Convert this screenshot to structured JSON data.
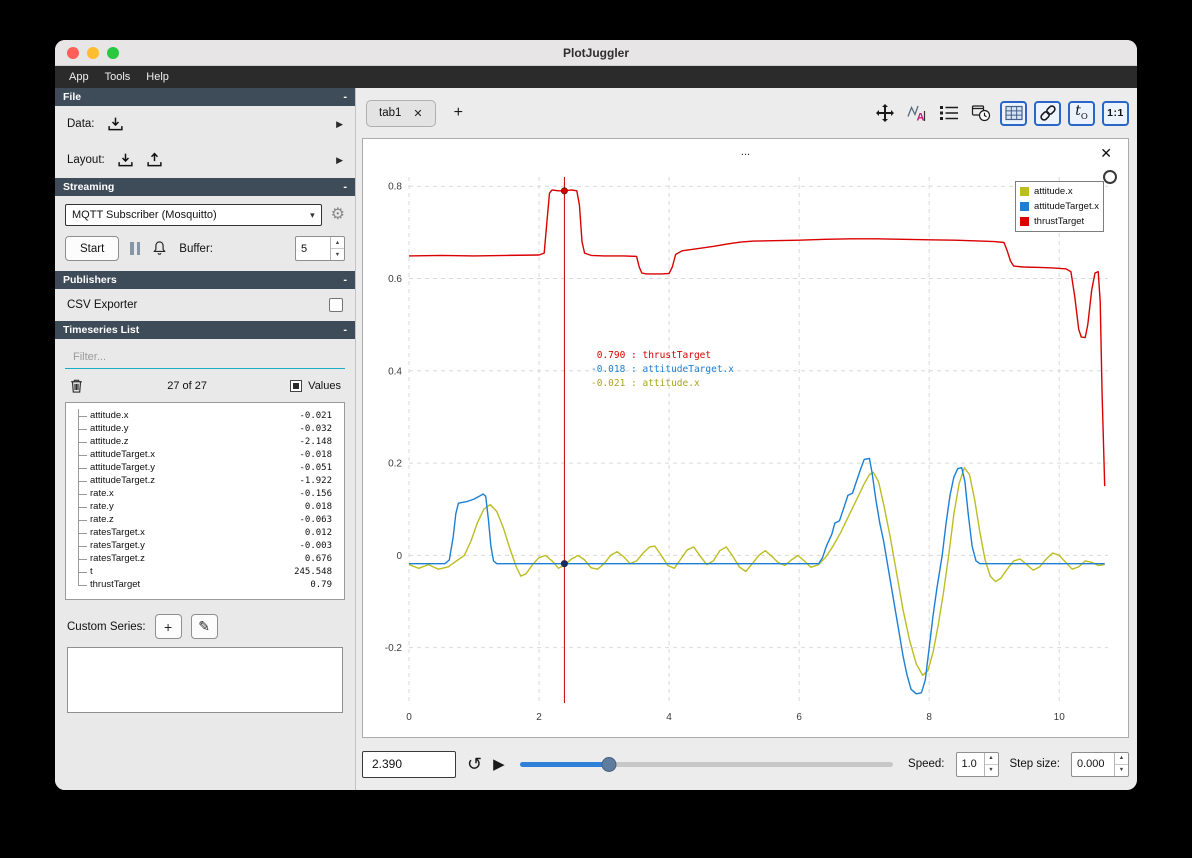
{
  "window": {
    "title": "PlotJuggler"
  },
  "menu": {
    "items": [
      "App",
      "Tools",
      "Help"
    ]
  },
  "icons": {
    "collapse": "-",
    "right_arrow": "▶",
    "chevron_down": "▾",
    "gear": "⚙",
    "pencil": "✎",
    "plus": "+",
    "close": "✕",
    "play": "▶",
    "loop": "↺",
    "up_arrow": "▲",
    "down_arrow": "▼",
    "t_main": "t",
    "t_sub": "O",
    "one_to_one": "1:1"
  },
  "sidebar": {
    "file": {
      "header": "File",
      "data_label": "Data:",
      "layout_label": "Layout:"
    },
    "streaming": {
      "header": "Streaming",
      "source": "MQTT Subscriber (Mosquitto)",
      "start_label": "Start",
      "buffer_label": "Buffer:",
      "buffer_value": "5"
    },
    "publishers": {
      "header": "Publishers",
      "csv_label": "CSV Exporter"
    },
    "timeseries": {
      "header": "Timeseries List",
      "filter_placeholder": "Filter...",
      "count": "27 of 27",
      "values_label": "Values",
      "custom_series_label": "Custom Series:",
      "items": [
        {
          "name": "attitude.x",
          "value": "-0.021"
        },
        {
          "name": "attitude.y",
          "value": "-0.032"
        },
        {
          "name": "attitude.z",
          "value": "-2.148"
        },
        {
          "name": "attitudeTarget.x",
          "value": "-0.018"
        },
        {
          "name": "attitudeTarget.y",
          "value": "-0.051"
        },
        {
          "name": "attitudeTarget.z",
          "value": "-1.922"
        },
        {
          "name": "rate.x",
          "value": "-0.156"
        },
        {
          "name": "rate.y",
          "value": "0.018"
        },
        {
          "name": "rate.z",
          "value": "-0.063"
        },
        {
          "name": "ratesTarget.x",
          "value": "0.012"
        },
        {
          "name": "ratesTarget.y",
          "value": "-0.003"
        },
        {
          "name": "ratesTarget.z",
          "value": "0.676"
        },
        {
          "name": "t",
          "value": "245.548"
        },
        {
          "name": "thrustTarget",
          "value": "0.79"
        }
      ]
    }
  },
  "tabbar": {
    "tab_label": "tab1"
  },
  "plot": {
    "title": "...",
    "legend": [
      {
        "label": "attitude.x",
        "color": "#bcbd22"
      },
      {
        "label": "attitudeTarget.x",
        "color": "#1c7fd4"
      },
      {
        "label": "thrustTarget",
        "color": "#d90000"
      }
    ],
    "tooltip": [
      {
        "value": " 0.790",
        "label": "thrustTarget",
        "color": "#d90000"
      },
      {
        "value": "-0.018",
        "label": "attitudeTarget.x",
        "color": "#1c7fd4"
      },
      {
        "value": "-0.021",
        "label": "attitude.x",
        "color": "#a9a418"
      }
    ]
  },
  "bottombar": {
    "time_value": "2.390",
    "speed_label": "Speed:",
    "speed_value": "1.0",
    "step_label": "Step size:",
    "step_value": "0.000",
    "slider_fraction": 0.24
  },
  "chart_data": {
    "type": "line",
    "title": "...",
    "xlabel": "",
    "ylabel": "",
    "xlim": [
      0,
      10.75
    ],
    "ylim": [
      -0.32,
      0.82
    ],
    "x_ticks": [
      0,
      2,
      4,
      6,
      8,
      10
    ],
    "y_ticks": [
      -0.2,
      0,
      0.2,
      0.4,
      0.6,
      0.8
    ],
    "grid": "dashed",
    "legend_position": "top-right",
    "cursor_x": 2.39,
    "cursor_points": [
      {
        "y": 0.79,
        "color": "#d90000"
      },
      {
        "y": -0.018,
        "color": "#1d2a66"
      }
    ],
    "series": [
      {
        "name": "attitude.x",
        "color": "#bcbd22",
        "points": [
          [
            0,
            -0.02
          ],
          [
            0.15,
            -0.028
          ],
          [
            0.3,
            -0.02
          ],
          [
            0.45,
            -0.03
          ],
          [
            0.6,
            -0.025
          ],
          [
            0.75,
            -0.01
          ],
          [
            0.85,
            0
          ],
          [
            0.95,
            0.03
          ],
          [
            1.05,
            0.07
          ],
          [
            1.15,
            0.1
          ],
          [
            1.25,
            0.11
          ],
          [
            1.35,
            0.095
          ],
          [
            1.45,
            0.06
          ],
          [
            1.55,
            0.015
          ],
          [
            1.65,
            -0.025
          ],
          [
            1.72,
            -0.045
          ],
          [
            1.8,
            -0.04
          ],
          [
            1.9,
            -0.02
          ],
          [
            2,
            -0.005
          ],
          [
            2.1,
            0
          ],
          [
            2.2,
            -0.012
          ],
          [
            2.3,
            -0.028
          ],
          [
            2.39,
            -0.021
          ],
          [
            2.5,
            -0.008
          ],
          [
            2.6,
            0
          ],
          [
            2.7,
            -0.01
          ],
          [
            2.8,
            -0.027
          ],
          [
            2.9,
            -0.03
          ],
          [
            3,
            -0.018
          ],
          [
            3.1,
            0
          ],
          [
            3.2,
            0.008
          ],
          [
            3.3,
            -0.003
          ],
          [
            3.4,
            -0.018
          ],
          [
            3.5,
            -0.012
          ],
          [
            3.6,
            0.005
          ],
          [
            3.7,
            0.018
          ],
          [
            3.78,
            0.02
          ],
          [
            3.88,
            0
          ],
          [
            3.98,
            -0.022
          ],
          [
            4.08,
            -0.028
          ],
          [
            4.18,
            -0.008
          ],
          [
            4.28,
            0.012
          ],
          [
            4.38,
            0.018
          ],
          [
            4.48,
            -0.002
          ],
          [
            4.58,
            -0.02
          ],
          [
            4.68,
            -0.012
          ],
          [
            4.78,
            0.01
          ],
          [
            4.88,
            0.018
          ],
          [
            4.98,
            -0.002
          ],
          [
            5.08,
            -0.025
          ],
          [
            5.18,
            -0.035
          ],
          [
            5.28,
            -0.018
          ],
          [
            5.38,
            0
          ],
          [
            5.48,
            0.01
          ],
          [
            5.58,
            -0.002
          ],
          [
            5.68,
            -0.016
          ],
          [
            5.78,
            -0.022
          ],
          [
            5.88,
            -0.01
          ],
          [
            5.98,
            0
          ],
          [
            6.08,
            -0.012
          ],
          [
            6.18,
            -0.026
          ],
          [
            6.3,
            -0.02
          ],
          [
            6.42,
            -0.002
          ],
          [
            6.52,
            0.02
          ],
          [
            6.64,
            0.05
          ],
          [
            6.76,
            0.085
          ],
          [
            6.88,
            0.12
          ],
          [
            7,
            0.155
          ],
          [
            7.08,
            0.175
          ],
          [
            7.14,
            0.18
          ],
          [
            7.22,
            0.16
          ],
          [
            7.3,
            0.11
          ],
          [
            7.4,
            0.04
          ],
          [
            7.5,
            -0.04
          ],
          [
            7.6,
            -0.12
          ],
          [
            7.7,
            -0.185
          ],
          [
            7.8,
            -0.235
          ],
          [
            7.9,
            -0.26
          ],
          [
            7.98,
            -0.25
          ],
          [
            8.06,
            -0.21
          ],
          [
            8.14,
            -0.15
          ],
          [
            8.22,
            -0.08
          ],
          [
            8.3,
            0
          ],
          [
            8.38,
            0.09
          ],
          [
            8.46,
            0.155
          ],
          [
            8.54,
            0.19
          ],
          [
            8.62,
            0.175
          ],
          [
            8.7,
            0.12
          ],
          [
            8.78,
            0.05
          ],
          [
            8.86,
            -0.01
          ],
          [
            8.94,
            -0.045
          ],
          [
            9.02,
            -0.057
          ],
          [
            9.1,
            -0.05
          ],
          [
            9.2,
            -0.03
          ],
          [
            9.3,
            -0.012
          ],
          [
            9.4,
            -0.008
          ],
          [
            9.5,
            -0.02
          ],
          [
            9.6,
            -0.032
          ],
          [
            9.7,
            -0.025
          ],
          [
            9.8,
            -0.008
          ],
          [
            9.9,
            0.005
          ],
          [
            10,
            0
          ],
          [
            10.1,
            -0.015
          ],
          [
            10.2,
            -0.03
          ],
          [
            10.3,
            -0.025
          ],
          [
            10.4,
            -0.012
          ],
          [
            10.5,
            -0.015
          ],
          [
            10.6,
            -0.022
          ],
          [
            10.7,
            -0.02
          ]
        ]
      },
      {
        "name": "attitudeTarget.x",
        "color": "#1c7fd4",
        "points": [
          [
            0,
            -0.018
          ],
          [
            0.55,
            -0.018
          ],
          [
            0.62,
            -0.01
          ],
          [
            0.68,
            0.04
          ],
          [
            0.72,
            0.09
          ],
          [
            0.76,
            0.113
          ],
          [
            0.9,
            0.117
          ],
          [
            1,
            0.122
          ],
          [
            1.08,
            0.128
          ],
          [
            1.14,
            0.133
          ],
          [
            1.18,
            0.128
          ],
          [
            1.22,
            0.08
          ],
          [
            1.26,
            0.02
          ],
          [
            1.3,
            -0.012
          ],
          [
            1.35,
            -0.018
          ],
          [
            2,
            -0.018
          ],
          [
            3,
            -0.018
          ],
          [
            4,
            -0.018
          ],
          [
            5,
            -0.018
          ],
          [
            6,
            -0.018
          ],
          [
            6.3,
            -0.018
          ],
          [
            6.36,
            -0.005
          ],
          [
            6.42,
            0.02
          ],
          [
            6.5,
            0.045
          ],
          [
            6.55,
            0.07
          ],
          [
            6.62,
            0.075
          ],
          [
            6.68,
            0.1
          ],
          [
            6.75,
            0.13
          ],
          [
            6.82,
            0.135
          ],
          [
            6.88,
            0.16
          ],
          [
            6.94,
            0.185
          ],
          [
            7,
            0.208
          ],
          [
            7.08,
            0.21
          ],
          [
            7.12,
            0.18
          ],
          [
            7.18,
            0.12
          ],
          [
            7.24,
            0.07
          ],
          [
            7.3,
            0.03
          ],
          [
            7.36,
            -0.02
          ],
          [
            7.42,
            -0.07
          ],
          [
            7.48,
            -0.12
          ],
          [
            7.54,
            -0.17
          ],
          [
            7.6,
            -0.22
          ],
          [
            7.66,
            -0.26
          ],
          [
            7.72,
            -0.29
          ],
          [
            7.8,
            -0.3
          ],
          [
            7.88,
            -0.298
          ],
          [
            7.94,
            -0.27
          ],
          [
            8,
            -0.2
          ],
          [
            8.06,
            -0.13
          ],
          [
            8.12,
            -0.07
          ],
          [
            8.2,
            0
          ],
          [
            8.26,
            0.07
          ],
          [
            8.32,
            0.13
          ],
          [
            8.38,
            0.17
          ],
          [
            8.44,
            0.188
          ],
          [
            8.5,
            0.19
          ],
          [
            8.55,
            0.16
          ],
          [
            8.6,
            0.09
          ],
          [
            8.66,
            0.02
          ],
          [
            8.72,
            -0.012
          ],
          [
            8.78,
            -0.018
          ],
          [
            9.2,
            -0.018
          ],
          [
            10,
            -0.018
          ],
          [
            10.7,
            -0.018
          ]
        ]
      },
      {
        "name": "thrustTarget",
        "color": "#d90000",
        "points": [
          [
            0,
            0.649
          ],
          [
            0.5,
            0.65
          ],
          [
            1,
            0.649
          ],
          [
            1.5,
            0.65
          ],
          [
            2,
            0.651
          ],
          [
            2.08,
            0.655
          ],
          [
            2.12,
            0.72
          ],
          [
            2.16,
            0.785
          ],
          [
            2.2,
            0.792
          ],
          [
            2.3,
            0.79
          ],
          [
            2.39,
            0.79
          ],
          [
            2.5,
            0.792
          ],
          [
            2.58,
            0.79
          ],
          [
            2.62,
            0.76
          ],
          [
            2.66,
            0.68
          ],
          [
            2.7,
            0.655
          ],
          [
            2.8,
            0.65
          ],
          [
            3,
            0.649
          ],
          [
            3.3,
            0.649
          ],
          [
            3.5,
            0.648
          ],
          [
            3.54,
            0.625
          ],
          [
            3.58,
            0.612
          ],
          [
            3.65,
            0.61
          ],
          [
            3.9,
            0.61
          ],
          [
            4,
            0.611
          ],
          [
            4.05,
            0.625
          ],
          [
            4.1,
            0.652
          ],
          [
            4.2,
            0.66
          ],
          [
            4.35,
            0.663
          ],
          [
            4.5,
            0.666
          ],
          [
            4.7,
            0.67
          ],
          [
            4.9,
            0.675
          ],
          [
            5.1,
            0.679
          ],
          [
            5.3,
            0.681
          ],
          [
            5.6,
            0.682
          ],
          [
            6,
            0.683
          ],
          [
            6.4,
            0.685
          ],
          [
            6.8,
            0.686
          ],
          [
            7.2,
            0.686
          ],
          [
            7.6,
            0.685
          ],
          [
            8,
            0.684
          ],
          [
            8.4,
            0.683
          ],
          [
            8.8,
            0.681
          ],
          [
            9,
            0.68
          ],
          [
            9.15,
            0.678
          ],
          [
            9.2,
            0.66
          ],
          [
            9.25,
            0.638
          ],
          [
            9.3,
            0.627
          ],
          [
            9.45,
            0.625
          ],
          [
            9.7,
            0.624
          ],
          [
            9.9,
            0.623
          ],
          [
            10.1,
            0.621
          ],
          [
            10.18,
            0.615
          ],
          [
            10.24,
            0.56
          ],
          [
            10.3,
            0.49
          ],
          [
            10.34,
            0.473
          ],
          [
            10.4,
            0.472
          ],
          [
            10.44,
            0.5
          ],
          [
            10.5,
            0.575
          ],
          [
            10.55,
            0.612
          ],
          [
            10.6,
            0.615
          ],
          [
            10.63,
            0.55
          ],
          [
            10.66,
            0.35
          ],
          [
            10.7,
            0.15
          ]
        ]
      }
    ]
  }
}
